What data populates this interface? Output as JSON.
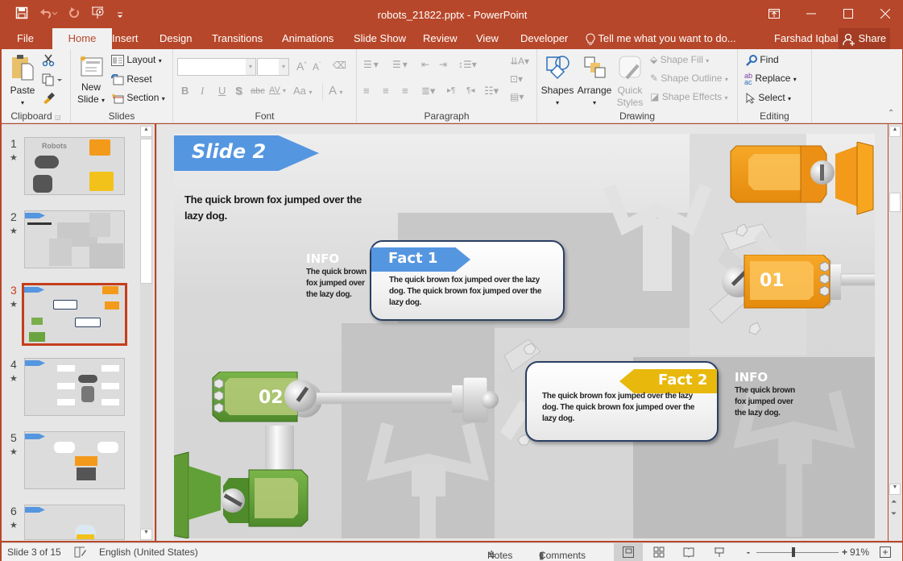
{
  "window": {
    "title": "robots_21822.pptx - PowerPoint",
    "controls": [
      "ribbon-display-options",
      "minimize",
      "maximize",
      "close"
    ]
  },
  "qat": {
    "save": "save-icon",
    "undo": "undo-icon",
    "redo": "redo-icon",
    "present": "start-from-beginning-icon",
    "customize": "customize-qat-icon"
  },
  "tabs": [
    {
      "label": "File"
    },
    {
      "label": "Home",
      "active": true
    },
    {
      "label": "Insert"
    },
    {
      "label": "Design"
    },
    {
      "label": "Transitions"
    },
    {
      "label": "Animations"
    },
    {
      "label": "Slide Show"
    },
    {
      "label": "Review"
    },
    {
      "label": "View"
    },
    {
      "label": "Developer"
    }
  ],
  "tellme": {
    "placeholder": "Tell me what you want to do..."
  },
  "user": {
    "name": "Farshad Iqbal",
    "share_label": "Share"
  },
  "ribbon": {
    "clipboard": {
      "label": "Clipboard",
      "paste": "Paste"
    },
    "slides": {
      "label": "Slides",
      "new_slide_1": "New",
      "new_slide_2": "Slide",
      "layout": "Layout",
      "reset": "Reset",
      "section": "Section"
    },
    "font": {
      "label": "Font",
      "font_name": "",
      "font_size": "",
      "bold": "B",
      "italic": "I",
      "underline": "U",
      "shadow": "S",
      "strike": "abc",
      "spacing": "AV",
      "case": "Aa",
      "color": "A",
      "grow": "A",
      "shrink": "A"
    },
    "paragraph": {
      "label": "Paragraph"
    },
    "drawing": {
      "label": "Drawing",
      "shapes": "Shapes",
      "arrange": "Arrange",
      "quick_styles_1": "Quick",
      "quick_styles_2": "Styles",
      "shape_fill": "Shape Fill",
      "shape_outline": "Shape Outline",
      "shape_effects": "Shape Effects"
    },
    "editing": {
      "label": "Editing",
      "find": "Find",
      "replace": "Replace",
      "select": "Select"
    }
  },
  "thumbnails": [
    {
      "number": "1",
      "title": "Robots",
      "active": false
    },
    {
      "number": "2",
      "title": "Slide 2",
      "active": false
    },
    {
      "number": "3",
      "title": "Slide 2",
      "active": true
    },
    {
      "number": "4",
      "title": "Slide 4",
      "active": false
    },
    {
      "number": "5",
      "title": "Slide 4",
      "active": false
    },
    {
      "number": "6",
      "title": "Slide 4",
      "active": false
    }
  ],
  "slide": {
    "title": "Slide 2",
    "heading": "The quick brown fox jumped over the lazy dog.",
    "info1": {
      "heading": "INFO",
      "text": "The quick brown fox jumped over the lazy dog."
    },
    "fact1": {
      "label": "Fact 1",
      "text": "The quick brown fox jumped over the lazy dog. The quick brown fox jumped over the lazy dog."
    },
    "fact2": {
      "label": "Fact 2",
      "text": "The quick brown fox jumped over the lazy dog. The quick brown fox jumped over the lazy dog."
    },
    "info2": {
      "heading": "INFO",
      "text": "The quick brown fox jumped over the lazy dog."
    },
    "robot1_number": "01",
    "robot2_number": "02",
    "colors": {
      "banner_blue": "#5596e0",
      "fact2_yellow": "#e8b90c",
      "orange": "#f39a1a",
      "green": "#6aa43e",
      "box_border": "#2b3f63"
    }
  },
  "status": {
    "slide_indicator": "Slide 3 of 15",
    "language": "English (United States)",
    "notes": "Notes",
    "comments": "Comments",
    "zoom": "91%",
    "zoom_value": 0.91
  }
}
